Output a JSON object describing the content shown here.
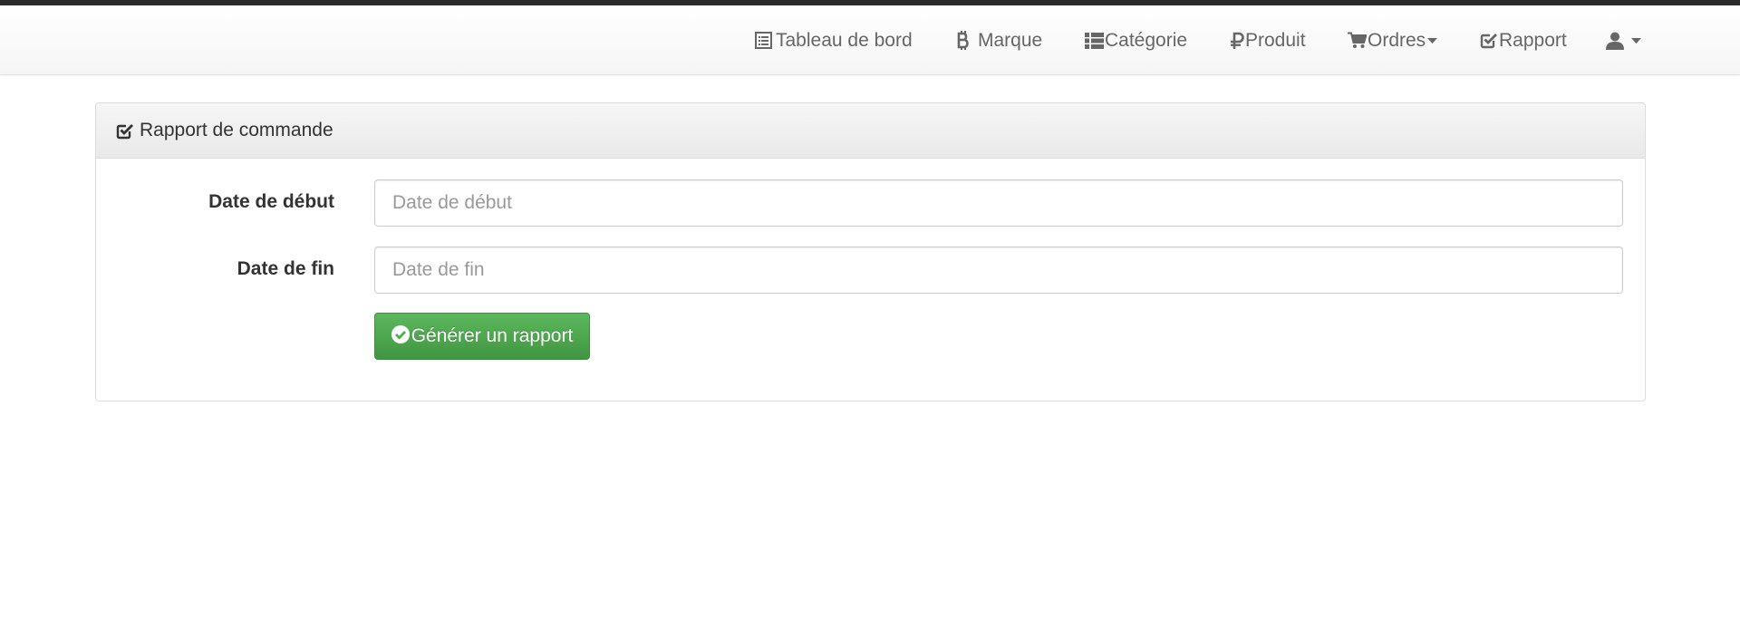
{
  "navbar": {
    "items": [
      {
        "label": "Tableau de bord",
        "icon": "list-alt-icon"
      },
      {
        "label": "Marque",
        "icon": "bitcoin-icon"
      },
      {
        "label": "Catégorie",
        "icon": "th-list-icon"
      },
      {
        "label": "Produit",
        "icon": "ruble-icon"
      },
      {
        "label": "Ordres",
        "icon": "shopping-cart-icon"
      },
      {
        "label": "Rapport",
        "icon": "check-square-icon"
      }
    ],
    "user_menu_icon": "user-icon"
  },
  "panel": {
    "title": "Rapport de commande",
    "icon": "check-square-icon"
  },
  "form": {
    "start_date": {
      "label": "Date de début",
      "placeholder": "Date de début",
      "value": ""
    },
    "end_date": {
      "label": "Date de fin",
      "placeholder": "Date de fin",
      "value": ""
    },
    "submit_label": "Générer un rapport",
    "submit_icon": "ok-sign-icon"
  },
  "colors": {
    "success": "#5cb85c",
    "nav_text": "#666666",
    "top_bar": "#2b2b2b"
  }
}
